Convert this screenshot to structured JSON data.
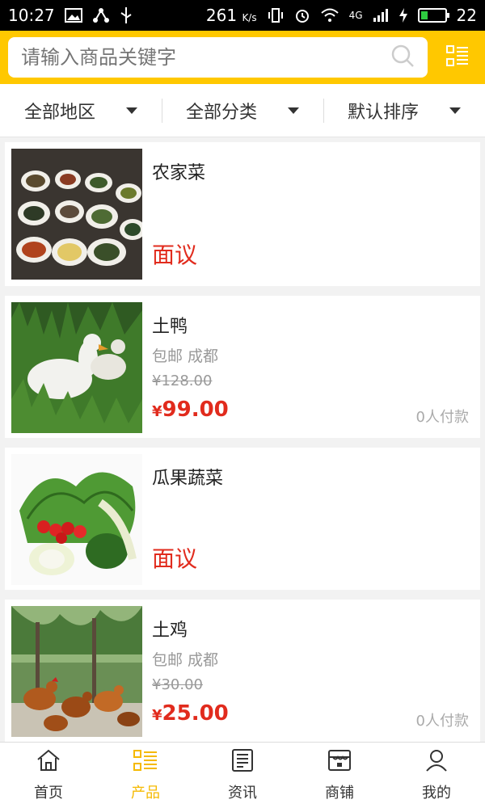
{
  "status_bar": {
    "time": "10:27",
    "speed": "261",
    "speed_unit": "K/s",
    "network": "4G",
    "battery": "22"
  },
  "search": {
    "placeholder": "请输入商品关键字",
    "icon": "search-icon",
    "menu_icon": "list-icon"
  },
  "filters": [
    {
      "label": "全部地区"
    },
    {
      "label": "全部分类"
    },
    {
      "label": "默认排序"
    }
  ],
  "products": [
    {
      "title": "农家菜",
      "price_text": "面议"
    },
    {
      "title": "土鸭",
      "sub": "包邮 成都",
      "old_price": "¥128.00",
      "currency": "¥",
      "price": "99.00",
      "paid": "0人付款"
    },
    {
      "title": "瓜果蔬菜",
      "price_text": "面议"
    },
    {
      "title": "土鸡",
      "sub": "包邮 成都",
      "old_price": "¥30.00",
      "currency": "¥",
      "price": "25.00",
      "paid": "0人付款"
    }
  ],
  "bottom_nav": [
    {
      "label": "首页",
      "icon": "home-icon"
    },
    {
      "label": "产品",
      "icon": "list-icon",
      "active": true
    },
    {
      "label": "资讯",
      "icon": "news-icon"
    },
    {
      "label": "商铺",
      "icon": "shop-icon"
    },
    {
      "label": "我的",
      "icon": "user-icon"
    }
  ],
  "colors": {
    "accent": "#ffc800",
    "price_red": "#e12b1d",
    "nav_active": "#f5b900"
  }
}
